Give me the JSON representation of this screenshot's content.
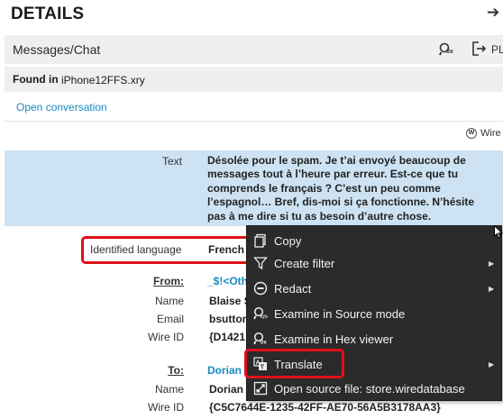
{
  "header": {
    "title": "DETAILS",
    "collapse_icon": "arrow-right-icon"
  },
  "record": {
    "type": "Messages/Chat",
    "toolbar_right_label": "PL",
    "found_in_label": "Found in",
    "found_in_value": "iPhone12FFS.xry",
    "open_conversation": "Open conversation",
    "source_badge": "Wire",
    "source_badge_mark": "W"
  },
  "fields": {
    "text_label": "Text",
    "text_value": "Désolée pour le spam. Je t’ai envoyé beaucoup de messages tout à l’heure par erreur. Est-ce que tu comprends le français ? C’est un peu comme l’espagnol… Bref, dis-moi si ça fonctionne. N’hésite pas à me dire si tu as besoin d’autre chose.",
    "identified_language_label": "Identified language",
    "identified_language_value": "French",
    "from_label": "From:",
    "from_value": "_$!<Oth",
    "from_name_label": "Name",
    "from_name_value": "Blaise S",
    "from_email_label": "Email",
    "from_email_value": "bsutton",
    "from_wire_id_label": "Wire ID",
    "from_wire_id_value": "{D1421",
    "to_label": "To:",
    "to_value": "Dorian",
    "to_name_label": "Name",
    "to_name_value": "Dorian",
    "to_wire_id_label": "Wire ID",
    "to_wire_id_value": "{C5C7644E-1235-42FF-AE70-56A5B3178AA3}"
  },
  "context_menu": {
    "items": [
      {
        "label": "Copy",
        "icon": "copy-icon",
        "submenu": false
      },
      {
        "label": "Create filter",
        "icon": "filter-icon",
        "submenu": true
      },
      {
        "label": "Redact",
        "icon": "redact-icon",
        "submenu": true
      },
      {
        "label": "Examine in Source mode",
        "icon": "examine-source-icon",
        "submenu": false
      },
      {
        "label": "Examine in Hex viewer",
        "icon": "examine-hex-icon",
        "submenu": false
      },
      {
        "label": "Translate",
        "icon": "translate-icon",
        "submenu": true
      },
      {
        "label": "Open source file: store.wiredatabase",
        "icon": "open-source-file-icon",
        "submenu": false
      }
    ]
  },
  "colors": {
    "highlight_row": "#cde3f3",
    "link": "#1a8ac2",
    "annotation_box": "#e0101a",
    "menu_bg": "#2b2b2b"
  }
}
